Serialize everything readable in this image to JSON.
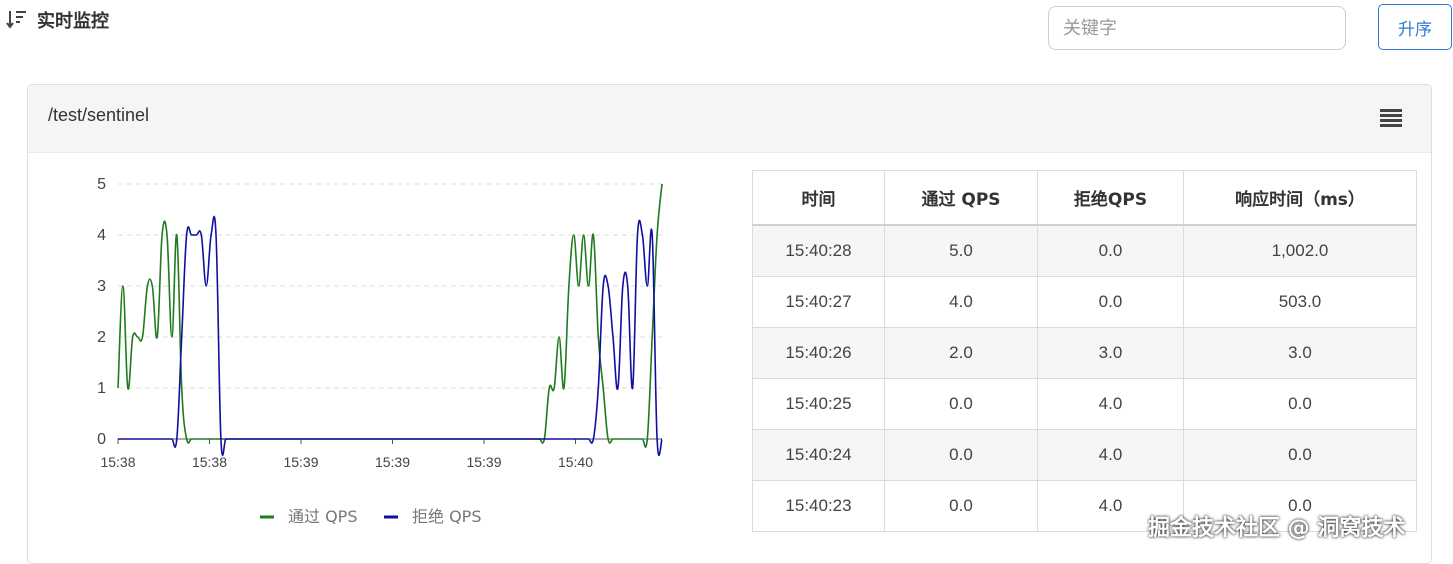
{
  "header": {
    "title": "实时监控",
    "search_placeholder": "关键字",
    "sort_label": "升序"
  },
  "panel": {
    "resource": "/test/sentinel"
  },
  "colors": {
    "pass": "#1e7b1e",
    "block": "#1010a0",
    "accent": "#2f7bd0"
  },
  "chart_data": {
    "type": "line",
    "y_ticks": [
      "0",
      "1",
      "2",
      "3",
      "4",
      "5"
    ],
    "ylim": [
      0,
      5
    ],
    "x_tick_labels": [
      "15:38",
      "15:38",
      "15:39",
      "15:39",
      "15:39",
      "15:40"
    ],
    "grid": true,
    "legend_position": "bottom",
    "series": [
      {
        "name": "通过 QPS",
        "color": "#1e7b1e",
        "values": [
          1,
          3,
          1,
          2,
          2,
          2,
          3,
          3,
          2,
          4,
          4,
          2,
          4,
          1,
          0,
          0,
          0,
          0,
          0,
          0,
          0,
          0,
          0,
          0,
          0,
          0,
          0,
          0,
          0,
          0,
          0,
          0,
          0,
          0,
          0,
          0,
          0,
          0,
          0,
          0,
          0,
          0,
          0,
          0,
          0,
          0,
          0,
          0,
          0,
          0,
          0,
          0,
          0,
          0,
          0,
          0,
          0,
          0,
          0,
          0,
          0,
          0,
          0,
          0,
          0,
          0,
          0,
          0,
          0,
          0,
          0,
          0,
          0,
          0,
          0,
          0,
          0,
          0,
          0,
          0,
          0,
          0,
          0,
          0,
          0,
          0,
          0,
          0,
          1,
          1,
          2,
          1,
          3,
          4,
          3,
          4,
          3,
          4,
          2,
          1,
          0,
          0,
          0,
          0,
          0,
          0,
          0,
          0,
          0,
          2,
          4,
          5
        ]
      },
      {
        "name": "拒绝 QPS",
        "color": "#1010a0",
        "values": [
          0,
          0,
          0,
          0,
          0,
          0,
          0,
          0,
          0,
          0,
          0,
          0,
          0,
          2,
          4,
          4,
          4,
          4,
          3,
          4,
          4,
          0,
          0,
          0,
          0,
          0,
          0,
          0,
          0,
          0,
          0,
          0,
          0,
          0,
          0,
          0,
          0,
          0,
          0,
          0,
          0,
          0,
          0,
          0,
          0,
          0,
          0,
          0,
          0,
          0,
          0,
          0,
          0,
          0,
          0,
          0,
          0,
          0,
          0,
          0,
          0,
          0,
          0,
          0,
          0,
          0,
          0,
          0,
          0,
          0,
          0,
          0,
          0,
          0,
          0,
          0,
          0,
          0,
          0,
          0,
          0,
          0,
          0,
          0,
          0,
          0,
          0,
          0,
          0,
          0,
          0,
          0,
          0,
          0,
          0,
          0,
          0,
          0,
          1,
          3,
          3,
          2,
          1,
          3,
          3,
          1,
          4,
          4,
          3,
          4,
          0,
          0
        ]
      }
    ]
  },
  "table": {
    "headers": [
      "时间",
      "通过 QPS",
      "拒绝QPS",
      "响应时间（ms）"
    ],
    "rows": [
      [
        "15:40:28",
        "5.0",
        "0.0",
        "1,002.0"
      ],
      [
        "15:40:27",
        "4.0",
        "0.0",
        "503.0"
      ],
      [
        "15:40:26",
        "2.0",
        "3.0",
        "3.0"
      ],
      [
        "15:40:25",
        "0.0",
        "4.0",
        "0.0"
      ],
      [
        "15:40:24",
        "0.0",
        "4.0",
        "0.0"
      ],
      [
        "15:40:23",
        "0.0",
        "4.0",
        "0.0"
      ]
    ]
  },
  "watermark": "掘金技术社区 @ 洞窝技术"
}
